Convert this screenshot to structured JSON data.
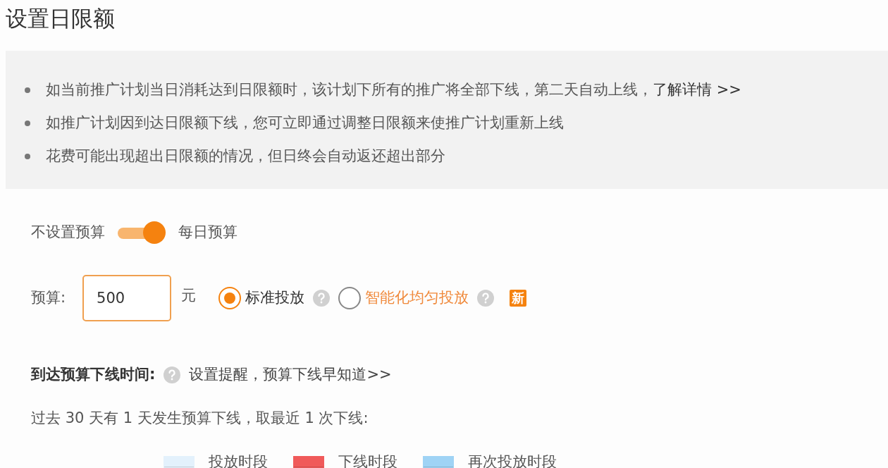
{
  "title": "设置日限额",
  "notices": [
    {
      "text": "如当前推广计划当日消耗达到日限额时，该计划下所有的推广将全部下线，第二天自动上线，",
      "link": "了解详情 >>"
    },
    {
      "text": "如推广计划因到达日限额下线，您可立即通过调整日限额来使推广计划重新上线"
    },
    {
      "text": "花费可能出现超出日限额的情况，但日终会自动返还超出部分"
    }
  ],
  "budget_toggle": {
    "off_label": "不设置预算",
    "on_label": "每日预算",
    "on": true
  },
  "budget": {
    "label": "预算:",
    "value": "500",
    "unit": "元"
  },
  "delivery_options": [
    {
      "label": "标准投放",
      "selected": true,
      "color": "#333333"
    },
    {
      "label": "智能化均匀投放",
      "selected": false,
      "color": "#f08a3c"
    }
  ],
  "new_badge": "新",
  "offline_time": {
    "label": "到达预算下线时间:",
    "link": "设置提醒，预算下线早知道>>"
  },
  "summary": "过去 30 天有 1 天发生预算下线，取最近 1 次下线:",
  "legend": [
    {
      "label": "投放时段",
      "color": "#e3f1fc"
    },
    {
      "label": "下线时段",
      "color": "#f05a5a"
    },
    {
      "label": "再次投放时段",
      "color": "#9fd3f5"
    }
  ]
}
